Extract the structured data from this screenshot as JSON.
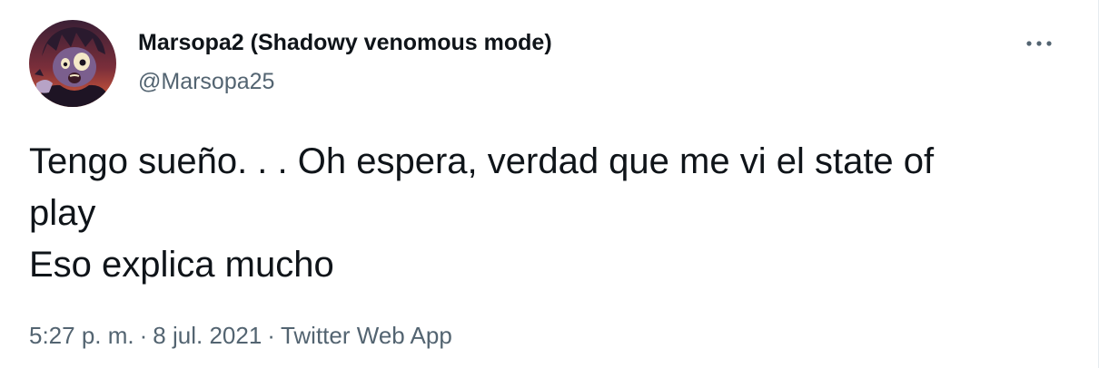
{
  "tweet": {
    "author": {
      "display_name": "Marsopa2 (Shadowy venomous mode)",
      "handle": "@Marsopa25",
      "avatar_icon": "cartoon-character-avatar"
    },
    "text_lines": [
      "Tengo sueño. . . Oh espera, verdad que me vi el state of",
      "play",
      "Eso explica mucho"
    ],
    "meta": {
      "time": "5:27 p. m.",
      "separator": "·",
      "date": "8 jul. 2021",
      "source": "Twitter Web App"
    },
    "more_icon": "more-horizontal-icon"
  },
  "colors": {
    "text_primary": "#0f1419",
    "text_secondary": "#536471",
    "border": "#e6ecf0"
  }
}
